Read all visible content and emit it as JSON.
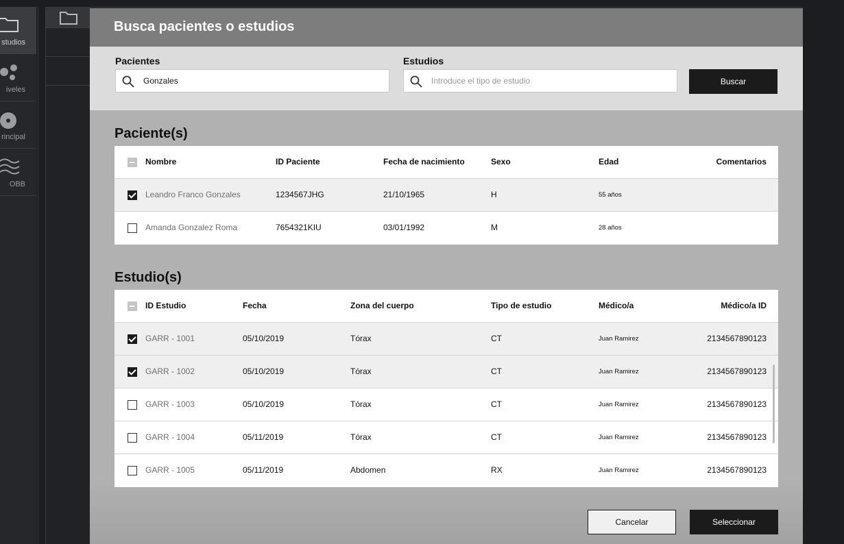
{
  "sidebar": {
    "items": [
      {
        "label": "studios",
        "icon": "folder-icon"
      },
      {
        "label": "iveles",
        "icon": "dots-icon"
      },
      {
        "label": "rincipal",
        "icon": "disc-icon"
      },
      {
        "label": "OBB",
        "icon": "waves-icon"
      }
    ]
  },
  "modal": {
    "title": "Busca pacientes o estudios",
    "search": {
      "patients_label": "Pacientes",
      "patients_value": "Gonzales",
      "studies_label": "Estudios",
      "studies_placeholder": "Introduce el tipo de estudio",
      "search_button": "Buscar"
    },
    "patients": {
      "title": "Paciente(s)",
      "columns": [
        "Nombre",
        "ID Paciente",
        "Fecha de nacimiento",
        "Sexo",
        "Edad",
        "Comentarios"
      ],
      "rows": [
        {
          "checked": true,
          "name": "Leandro Franco Gonzales",
          "id": "1234567JHG",
          "dob": "21/10/1965",
          "sex": "H",
          "age": "55 años",
          "comments": ""
        },
        {
          "checked": false,
          "name": "Amanda Gonzalez Roma",
          "id": "7654321KIU",
          "dob": "03/01/1992",
          "sex": "M",
          "age": "28 años",
          "comments": ""
        }
      ]
    },
    "studies": {
      "title": "Estudio(s)",
      "columns": [
        "ID Estudio",
        "Fecha",
        "Zona del cuerpo",
        "Tipo de estudio",
        "Médico/a",
        "Médico/a ID"
      ],
      "rows": [
        {
          "checked": true,
          "id": "GARR - 1001",
          "date": "05/10/2019",
          "zone": "Tórax",
          "type": "CT",
          "doctor": "Juan Ramirez",
          "doctor_id": "2134567890123"
        },
        {
          "checked": true,
          "id": "GARR - 1002",
          "date": "05/10/2019",
          "zone": "Tórax",
          "type": "CT",
          "doctor": "Juan Ramirez",
          "doctor_id": "2134567890123"
        },
        {
          "checked": false,
          "id": "GARR - 1003",
          "date": "05/10/2019",
          "zone": "Tórax",
          "type": "CT",
          "doctor": "Juan Ramirez",
          "doctor_id": "2134567890123"
        },
        {
          "checked": false,
          "id": "GARR - 1004",
          "date": "05/11/2019",
          "zone": "Tórax",
          "type": "CT",
          "doctor": "Juan Ramirez",
          "doctor_id": "2134567890123"
        },
        {
          "checked": false,
          "id": "GARR - 1005",
          "date": "05/11/2019",
          "zone": "Abdomen",
          "type": "RX",
          "doctor": "Juan Ramirez",
          "doctor_id": "2134567890123"
        }
      ]
    },
    "footer": {
      "cancel": "Cancelar",
      "select": "Seleccionar"
    }
  }
}
